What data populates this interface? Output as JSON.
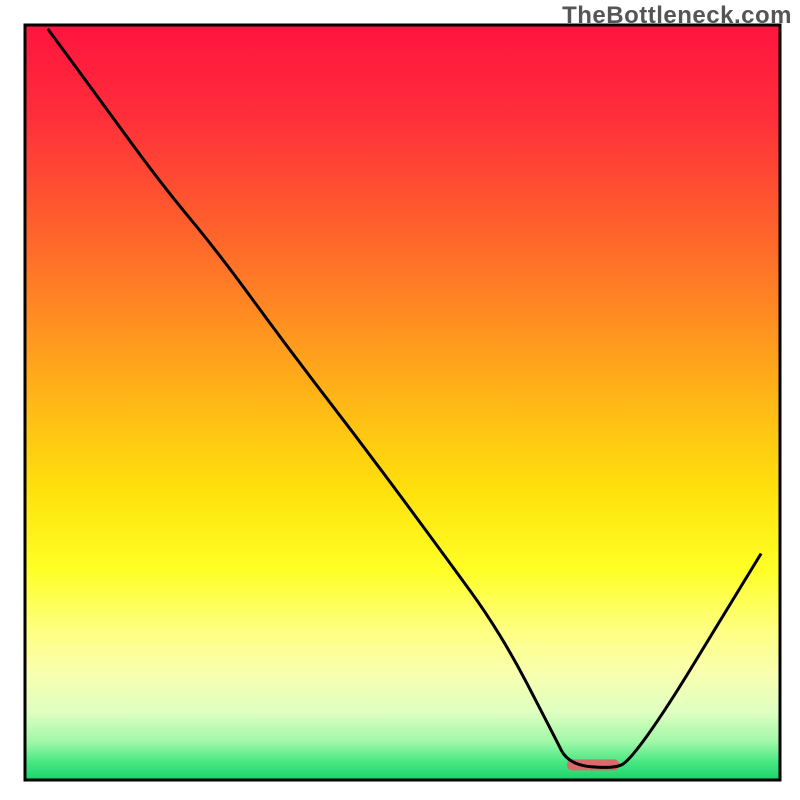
{
  "watermark": "TheBottleneck.com",
  "chart_data": {
    "type": "line",
    "title": "",
    "xlabel": "",
    "ylabel": "",
    "xlim": [
      0,
      100
    ],
    "ylim": [
      0,
      100
    ],
    "axes_visible": false,
    "background_gradient": {
      "stops": [
        {
          "offset": 0.0,
          "color": "#ff143f"
        },
        {
          "offset": 0.12,
          "color": "#ff2e3a"
        },
        {
          "offset": 0.25,
          "color": "#ff5a2e"
        },
        {
          "offset": 0.38,
          "color": "#ff8a22"
        },
        {
          "offset": 0.5,
          "color": "#ffb816"
        },
        {
          "offset": 0.62,
          "color": "#ffe20c"
        },
        {
          "offset": 0.72,
          "color": "#ffff25"
        },
        {
          "offset": 0.8,
          "color": "#ffff80"
        },
        {
          "offset": 0.86,
          "color": "#f8ffb0"
        },
        {
          "offset": 0.91,
          "color": "#dfffc0"
        },
        {
          "offset": 0.95,
          "color": "#9ff7a8"
        },
        {
          "offset": 0.975,
          "color": "#4be884"
        },
        {
          "offset": 1.0,
          "color": "#18d46a"
        }
      ]
    },
    "series": [
      {
        "name": "bottleneck-curve",
        "color": "#000000",
        "x": [
          3.0,
          10.0,
          18.0,
          25.5,
          35.0,
          45.0,
          55.0,
          63.0,
          70.0,
          72.0,
          78.0,
          80.0,
          85.0,
          92.0,
          97.5
        ],
        "y": [
          99.5,
          90.0,
          79.0,
          70.0,
          57.0,
          44.0,
          30.5,
          19.5,
          6.0,
          2.0,
          1.5,
          2.5,
          9.5,
          21.0,
          30.0
        ]
      }
    ],
    "marker": {
      "name": "sweet-spot-marker",
      "x_range": [
        72.5,
        78.0
      ],
      "y": 2.0,
      "color": "#dd6a6a",
      "thickness": 11
    }
  }
}
